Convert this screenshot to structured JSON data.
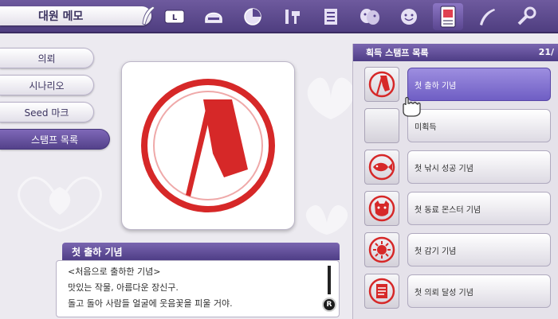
{
  "header": {
    "title": "대원 메모",
    "tabs": [
      {
        "icon": "l-button-icon",
        "label": "L"
      },
      {
        "icon": "helmet-icon"
      },
      {
        "icon": "pie-chart-icon"
      },
      {
        "icon": "sword-hammer-icon"
      },
      {
        "icon": "grid-list-icon"
      },
      {
        "icon": "theater-mask-icon"
      },
      {
        "icon": "smiley-icon"
      },
      {
        "icon": "memo-card-icon",
        "active": true
      },
      {
        "icon": "quill-icon"
      },
      {
        "icon": "wrench-icon"
      }
    ]
  },
  "menu": {
    "items": [
      {
        "label": "의뢰"
      },
      {
        "label": "시나리오"
      },
      {
        "label": "Seed 마크"
      },
      {
        "label": "스탬프 목록",
        "active": true
      }
    ]
  },
  "detail": {
    "title": "첫 출하 기념",
    "lines": [
      "<처음으로 출하한 기념>",
      "맛있는 작물, 아름다운 장신구.",
      "돌고 돌아 사람들 얼굴에 웃음꽃을 피울 거야."
    ],
    "r_button": "R"
  },
  "list": {
    "header": "획득 스탬프 목록",
    "count": "21/",
    "items": [
      {
        "label": "첫 출하 기념",
        "icon": "shipping-stamp-icon",
        "selected": true
      },
      {
        "label": "미획득",
        "icon": "empty-slot"
      },
      {
        "label": "첫 낚시 성공 기념",
        "icon": "fish-stamp-icon"
      },
      {
        "label": "첫 동료 몬스터 기념",
        "icon": "monster-stamp-icon"
      },
      {
        "label": "첫 감기 기념",
        "icon": "virus-stamp-icon"
      },
      {
        "label": "첫 의뢰 달성 기념",
        "icon": "document-stamp-icon"
      }
    ]
  },
  "colors": {
    "stamp_red": "#d62828",
    "accent_purple": "#5a4690",
    "selected_row": "#7d6cd0"
  }
}
